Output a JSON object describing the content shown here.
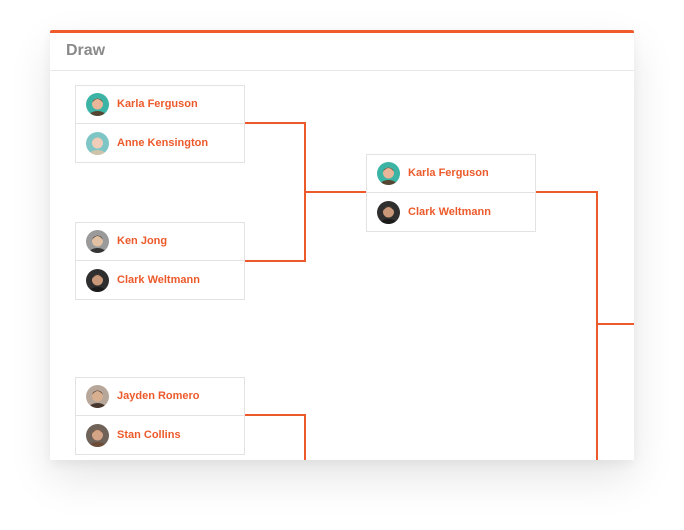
{
  "panel": {
    "title": "Draw",
    "accent_color": "#ef5b2d",
    "line_color": "#ec5a2b"
  },
  "matches": [
    {
      "round": 1,
      "players": [
        {
          "name": "Karla Ferguson",
          "avatar": "avatar-karla-ferguson",
          "avatar_bg": "#3bb4a5",
          "skin": "#e8b79a",
          "hair": "#5a3825"
        },
        {
          "name": "Anne Kensington",
          "avatar": "avatar-anne-kensington",
          "avatar_bg": "#7ec6c6",
          "skin": "#f0cdb9",
          "hair": "#d7c3a5"
        }
      ]
    },
    {
      "round": 1,
      "players": [
        {
          "name": "Ken Jong",
          "avatar": "avatar-ken-jong",
          "avatar_bg": "#9a9a9a",
          "skin": "#e2c0a3",
          "hair": "#2a2a2a"
        },
        {
          "name": "Clark Weltmann",
          "avatar": "avatar-clark-weltmann",
          "avatar_bg": "#2f2f2f",
          "skin": "#c89878",
          "hair": "#1a1a1a"
        }
      ]
    },
    {
      "round": 1,
      "players": [
        {
          "name": "Jayden Romero",
          "avatar": "avatar-jayden-romero",
          "avatar_bg": "#b7a79a",
          "skin": "#d9b08f",
          "hair": "#3a2a20"
        },
        {
          "name": "Stan Collins",
          "avatar": "avatar-stan-collins",
          "avatar_bg": "#6f6258",
          "skin": "#d5a487",
          "hair": "#6b4a33"
        }
      ]
    },
    {
      "round": 2,
      "players": [
        {
          "name": "Karla Ferguson",
          "avatar": "avatar-karla-ferguson",
          "avatar_bg": "#3bb4a5",
          "skin": "#e8b79a",
          "hair": "#5a3825"
        },
        {
          "name": "Clark Weltmann",
          "avatar": "avatar-clark-weltmann",
          "avatar_bg": "#2f2f2f",
          "skin": "#c89878",
          "hair": "#1a1a1a"
        }
      ]
    }
  ]
}
